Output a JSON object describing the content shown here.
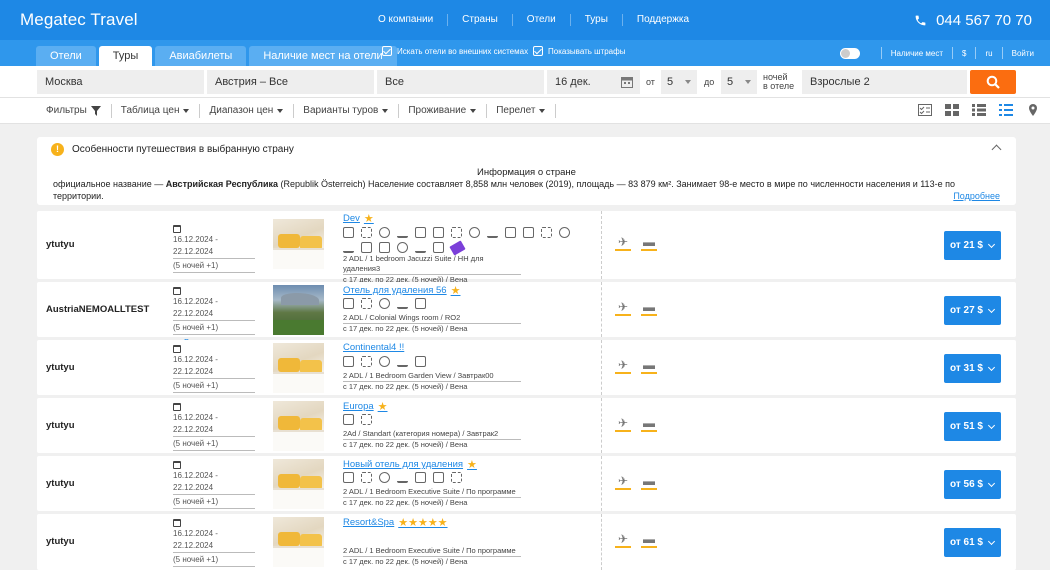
{
  "app": {
    "logo": "Megatec Travel",
    "phone": "044 567 70 70"
  },
  "topnav": [
    "О компании",
    "Страны",
    "Отели",
    "Туры",
    "Поддержка"
  ],
  "tabs": [
    "Отели",
    "Туры",
    "Авиабилеты",
    "Наличие мест на отели"
  ],
  "options": {
    "external": "Искать отели во внешних системах",
    "penalties": "Показывать штрафы",
    "availability": "Наличие мест",
    "currency": "$",
    "lang": "ru",
    "login": "Войти"
  },
  "search": {
    "from": "Москва",
    "country": "Австрия – Все",
    "city": "Все",
    "date": "16 дек.",
    "nights_from_label": "от",
    "nights_from": "5",
    "nights_to_label": "до",
    "nights_to": "5",
    "nights_label_1": "ночей",
    "nights_label_2": "в отеле",
    "tourists": "Взрослые 2"
  },
  "filters": [
    "Фильтры",
    "Таблица цен",
    "Диапазон цен",
    "Варианты туров",
    "Проживание",
    "Перелет"
  ],
  "info": {
    "header": "Особенности путешествия в выбранную страну",
    "title": "Информация о стране",
    "text_prefix": "официальное название — ",
    "text_bold": "Австрийская Республика",
    "text_rest": " (Republik Österreich) Население составляет 8,858 млн человек (2019), площадь — 83 879 км². Занимает 98-е место в мире по численности населения и 113-е по территории.",
    "more": "Подробнее"
  },
  "rows": [
    {
      "operator": "ytutyu",
      "dates": "16.12.2024 - 22.12.2024",
      "nights": "(5 ночей +1)",
      "hotel": "Dev",
      "stars": "★",
      "room": "2 ADL / 1 bedroom Jacuzzi Suite / НН для удаления3",
      "period": "с 17 дек. по 22 дек. (5 ночей) / Вена",
      "price": "от 21 $"
    },
    {
      "operator": "AustriaNEMOALLTEST",
      "dates": "16.12.2024 - 22.12.2024",
      "nights": "(5 ночей +1)",
      "place": "Вена",
      "hotel": "Отель для удаления 56",
      "stars": "★",
      "room": "2 ADL / Colonial Wings room / RO2",
      "period": "с 17 дек. по 22 дек. (5 ночей) / Вена",
      "price": "от 27 $"
    },
    {
      "operator": "ytutyu",
      "dates": "16.12.2024 - 22.12.2024",
      "nights": "(5 ночей +1)",
      "hotel": "Continental4 !!",
      "stars": "",
      "room": "2 ADL / 1 Bedroom Garden View / Завтрак00",
      "period": "с 17 дек. по 22 дек. (5 ночей) / Вена",
      "price": "от 31 $"
    },
    {
      "operator": "ytutyu",
      "dates": "16.12.2024 - 22.12.2024",
      "nights": "(5 ночей +1)",
      "hotel": "Europa",
      "stars": "★",
      "room": "2Ad / Standart (категория номера) / Завтрак2",
      "period": "с 17 дек. по 22 дек. (5 ночей) / Вена",
      "price": "от 51 $"
    },
    {
      "operator": "ytutyu",
      "dates": "16.12.2024 - 22.12.2024",
      "nights": "(5 ночей +1)",
      "hotel": "Новый отель для удаления",
      "stars": "★",
      "room": "2 ADL / 1 Bedroom Executive Suite / По программе",
      "period": "с 17 дек. по 22 дек. (5 ночей) / Вена",
      "price": "от 56 $"
    },
    {
      "operator": "ytutyu",
      "dates": "16.12.2024 - 22.12.2024",
      "nights": "(5 ночей +1)",
      "hotel": "Resort&Spa",
      "stars": "★★★★★",
      "room": "2 ADL / 1 Bedroom Executive Suite / По программе",
      "period": "с 17 дек. по 22 дек. (5 ночей) / Вена",
      "price": "от 61 $"
    }
  ]
}
